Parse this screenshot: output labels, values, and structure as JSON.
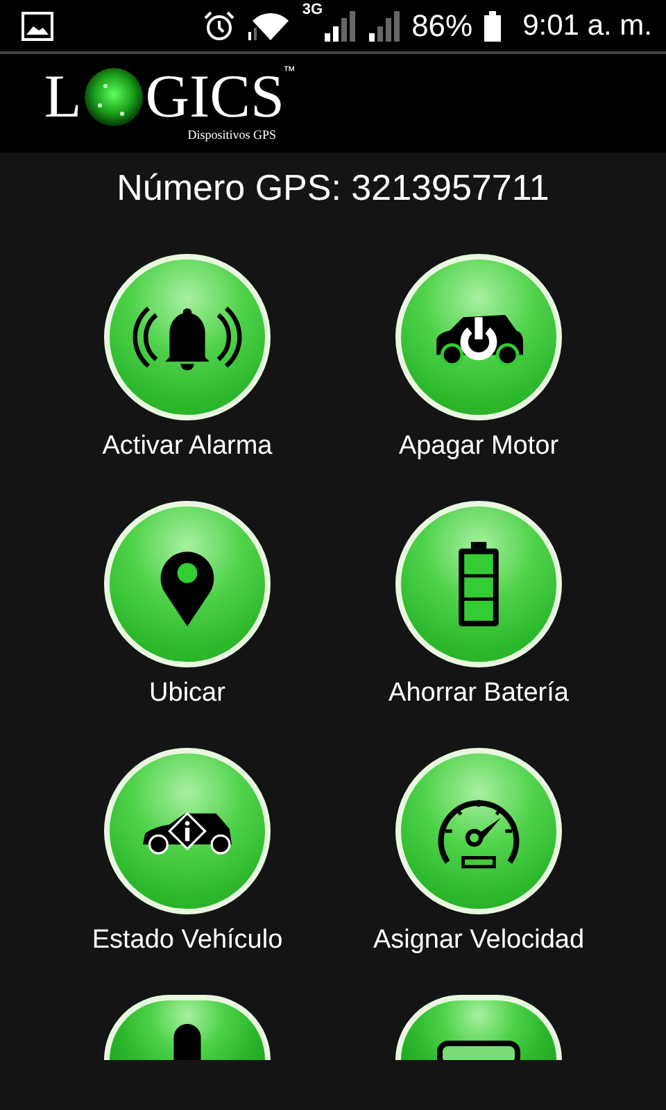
{
  "status_bar": {
    "network": "3G",
    "battery": "86%",
    "time": "9:01 a. m."
  },
  "logo": {
    "first_letter": "L",
    "rest": "GICS",
    "trademark": "™",
    "tagline": "Dispositivos GPS"
  },
  "title": "Número GPS: 3213957711",
  "actions": [
    {
      "kind": "bell",
      "label": "Activar Alarma"
    },
    {
      "kind": "car-power",
      "label": "Apagar Motor"
    },
    {
      "kind": "pin",
      "label": "Ubicar"
    },
    {
      "kind": "battery",
      "label": "Ahorrar Batería"
    },
    {
      "kind": "car-info",
      "label": "Estado Vehículo"
    },
    {
      "kind": "gauge",
      "label": "Asignar Velocidad"
    },
    {
      "kind": "capsule"
    },
    {
      "kind": "slot"
    }
  ]
}
